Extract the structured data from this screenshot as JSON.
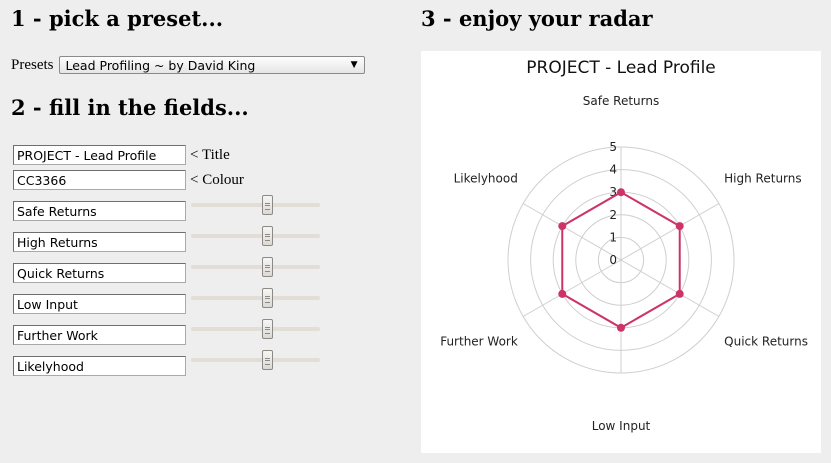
{
  "step1": {
    "heading": "1 - pick a preset..."
  },
  "step2": {
    "heading": "2 - fill in the fields..."
  },
  "step3": {
    "heading": "3 - enjoy your radar"
  },
  "presets": {
    "label": "Presets",
    "selected": "Lead Profiling ~ by David King"
  },
  "fields": {
    "title": {
      "value": "PROJECT - Lead Profile",
      "hint": "< Title"
    },
    "colour": {
      "value": "CC3366",
      "hint": "< Colour"
    }
  },
  "axes": [
    {
      "label": "Safe Returns",
      "value": 3
    },
    {
      "label": "High Returns",
      "value": 3
    },
    {
      "label": "Quick Returns",
      "value": 3
    },
    {
      "label": "Low Input",
      "value": 3
    },
    {
      "label": "Further Work",
      "value": 3
    },
    {
      "label": "Likelyhood",
      "value": 3
    }
  ],
  "slider": {
    "min": 0,
    "max": 5
  },
  "chart_data": {
    "type": "radar",
    "title": "PROJECT - Lead Profile",
    "categories": [
      "Safe Returns",
      "High Returns",
      "Quick Returns",
      "Low Input",
      "Further Work",
      "Likelyhood"
    ],
    "values": [
      3,
      3,
      3,
      3,
      3,
      3
    ],
    "rlim": [
      0,
      5
    ],
    "ticks": [
      "0",
      "1",
      "2",
      "3",
      "4",
      "5"
    ],
    "color": "#CC3366",
    "grid": true
  }
}
